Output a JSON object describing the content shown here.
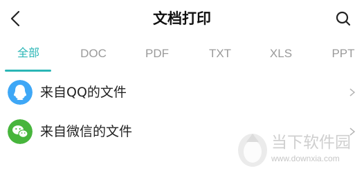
{
  "header": {
    "title": "文档打印",
    "back_icon": "chevron-left-icon",
    "search_icon": "search-icon"
  },
  "tabs": [
    {
      "label": "全部",
      "active": true
    },
    {
      "label": "DOC",
      "active": false
    },
    {
      "label": "PDF",
      "active": false
    },
    {
      "label": "TXT",
      "active": false
    },
    {
      "label": "XLS",
      "active": false
    },
    {
      "label": "PPT",
      "active": false
    }
  ],
  "list": [
    {
      "label": "来自QQ的文件",
      "icon": "qq-icon",
      "icon_color": "#3ea7f6"
    },
    {
      "label": "来自微信的文件",
      "icon": "wechat-icon",
      "icon_color": "#47b53c"
    }
  ],
  "watermark": {
    "name": "当下软件园",
    "url": "www.downxia.com",
    "logo_icon": "downxia-logo-icon"
  },
  "colors": {
    "accent": "#2ab6b6",
    "qq": "#3ea7f6",
    "wechat": "#47b53c"
  }
}
